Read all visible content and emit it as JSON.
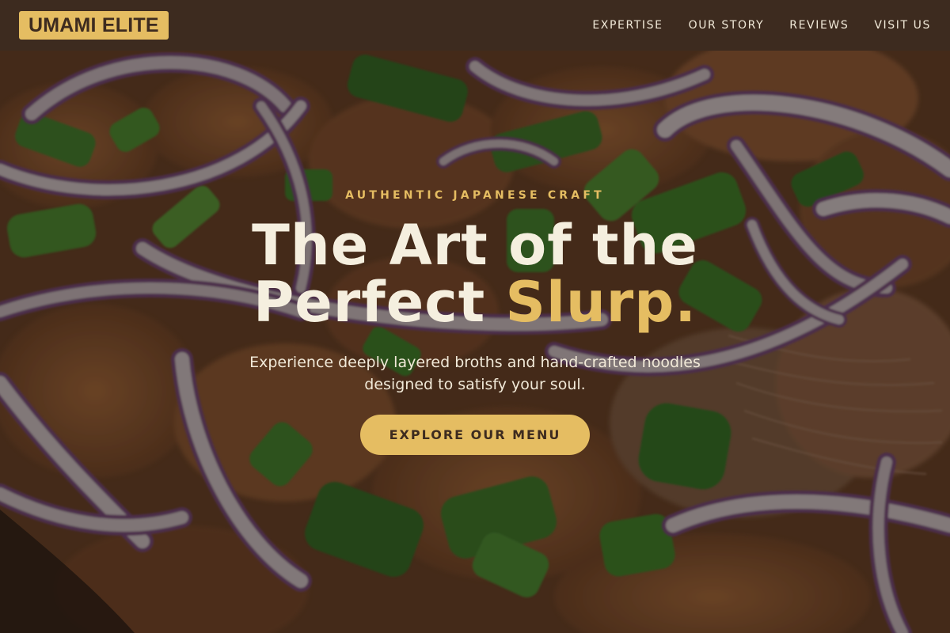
{
  "brand": {
    "logo_text": "UMAMI ELITE"
  },
  "nav": {
    "items": [
      {
        "label": "EXPERTISE"
      },
      {
        "label": "OUR STORY"
      },
      {
        "label": "REVIEWS"
      },
      {
        "label": "VISIT US"
      }
    ]
  },
  "hero": {
    "eyebrow": "AUTHENTIC JAPANESE CRAFT",
    "headline_line1": "The Art of the",
    "headline_line2_main": "Perfect ",
    "headline_line2_accent": "Slurp.",
    "subtitle": "Experience deeply layered broths and hand-crafted noodles designed to satisfy your soul.",
    "cta_label": "EXPLORE OUR MENU",
    "background_image": "close-up of noodle bowl with red onion rings and green onion"
  },
  "colors": {
    "header_bg": "#3d2b1f",
    "accent_gold": "#e5bd62",
    "text_light": "#f5efdf",
    "dark_brown": "#3d2b1f"
  }
}
